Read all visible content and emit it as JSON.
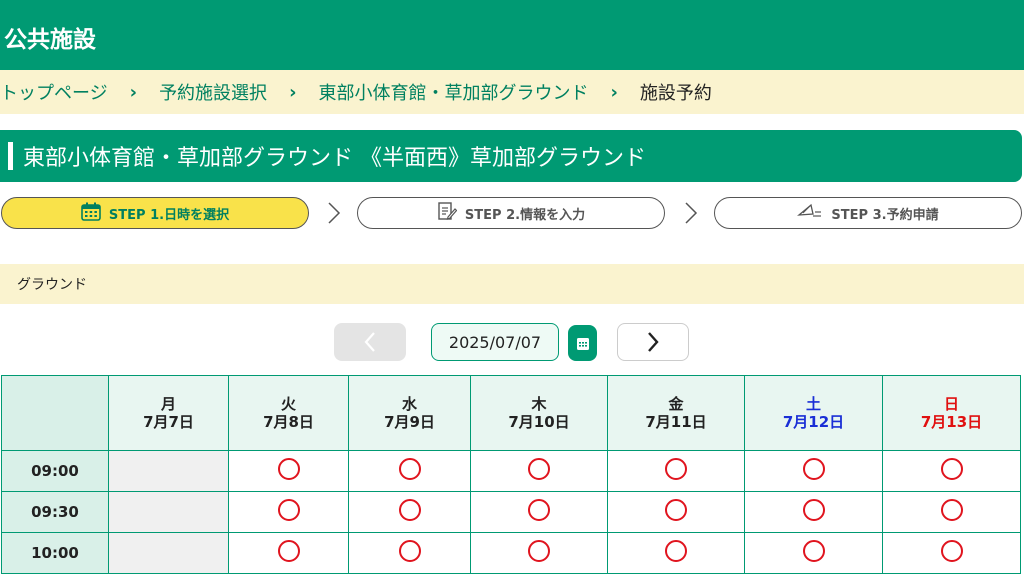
{
  "header": {
    "title": "公共施設"
  },
  "breadcrumb": {
    "items": [
      "トップページ",
      "予約施設選択",
      "東部小体育館・草加部グラウンド",
      "施設予約"
    ],
    "separator": "›"
  },
  "facility": {
    "name": "東部小体育館・草加部グラウンド 《半面西》草加部グラウンド"
  },
  "steps": [
    {
      "label": "STEP 1.日時を選択",
      "icon": "calendar-icon",
      "active": true
    },
    {
      "label": "STEP 2.情報を入力",
      "icon": "form-edit-icon",
      "active": false
    },
    {
      "label": "STEP 3.予約申請",
      "icon": "send-icon",
      "active": false
    }
  ],
  "section": {
    "label": "グラウンド"
  },
  "nav": {
    "date": "2025/07/07",
    "prev_icon": "chevron-left-icon",
    "next_icon": "chevron-right-icon",
    "calendar_icon": "calendar-icon"
  },
  "colors": {
    "brand": "#009a73",
    "highlight": "#faf3cf",
    "step_active": "#f9e24a",
    "available": "#e0141e",
    "saturday": "#1a2fd6",
    "sunday": "#e01010"
  },
  "table": {
    "days": [
      {
        "dow": "月",
        "date": "7月7日"
      },
      {
        "dow": "火",
        "date": "7月8日"
      },
      {
        "dow": "水",
        "date": "7月9日"
      },
      {
        "dow": "木",
        "date": "7月10日"
      },
      {
        "dow": "金",
        "date": "7月11日"
      },
      {
        "dow": "土",
        "date": "7月12日"
      },
      {
        "dow": "日",
        "date": "7月13日"
      }
    ],
    "rows": [
      {
        "time": "09:00",
        "slots": [
          "closed",
          "available",
          "available",
          "available",
          "available",
          "available",
          "available"
        ]
      },
      {
        "time": "09:30",
        "slots": [
          "closed",
          "available",
          "available",
          "available",
          "available",
          "available",
          "available"
        ]
      },
      {
        "time": "10:00",
        "slots": [
          "closed",
          "available",
          "available",
          "available",
          "available",
          "available",
          "available"
        ]
      }
    ]
  }
}
